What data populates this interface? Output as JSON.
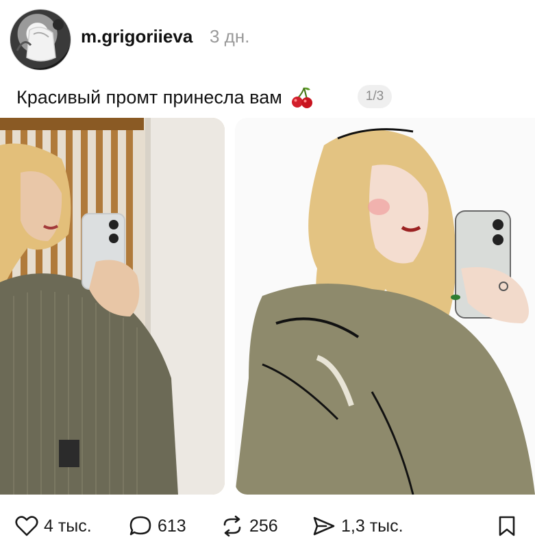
{
  "post": {
    "username": "m.grigoriieva",
    "time_ago": "3 дн.",
    "caption": "Красивый промт принесла вам",
    "caption_emoji": "cherry-icon",
    "media_counter": "1/3"
  },
  "media": [
    {
      "kind": "photo",
      "name": "mirror-selfie-photo"
    },
    {
      "kind": "illustration",
      "name": "mirror-selfie-illustration"
    }
  ],
  "actions": {
    "likes": "4 тыс.",
    "comments": "613",
    "reposts": "256",
    "shares": "1,3 тыс."
  },
  "colors": {
    "muted": "#999999",
    "counter_bg": "#efefef",
    "cherry": "#d21f2b"
  }
}
